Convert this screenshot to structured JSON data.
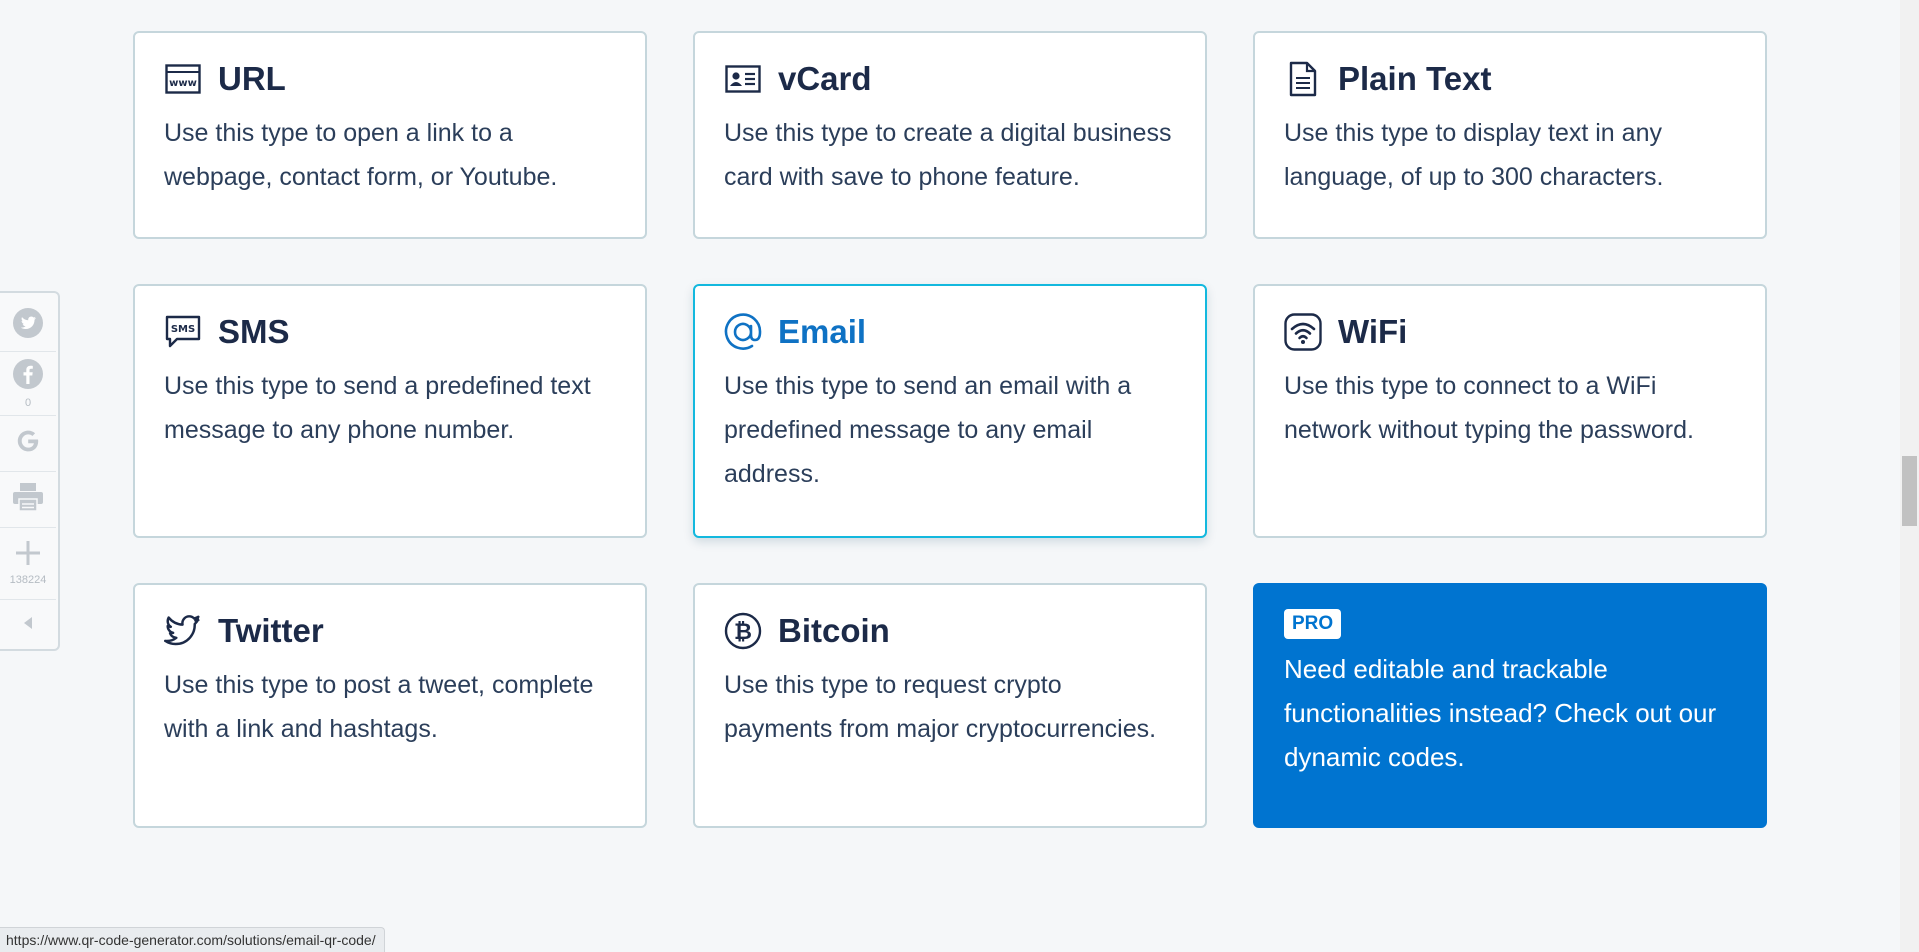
{
  "cards": [
    {
      "icon": "www-icon",
      "title": "URL",
      "desc": "Use this type to open a link to a webpage, contact form, or Youtube."
    },
    {
      "icon": "vcard-icon",
      "title": "vCard",
      "desc": "Use this type to create a digital business card with save to phone feature."
    },
    {
      "icon": "document-icon",
      "title": "Plain Text",
      "desc": "Use this type to display text in any language, of up to 300 characters."
    },
    {
      "icon": "sms-icon",
      "title": "SMS",
      "desc": "Use this type to send a predefined text message to any phone number."
    },
    {
      "icon": "at-icon",
      "title": "Email",
      "desc": "Use this type to send an email with a predefined message to any email address."
    },
    {
      "icon": "wifi-icon",
      "title": "WiFi",
      "desc": "Use this type to connect to a WiFi network without typing the password."
    },
    {
      "icon": "twitter-icon",
      "title": "Twitter",
      "desc": "Use this type to post a tweet, complete with a link and hashtags."
    },
    {
      "icon": "bitcoin-icon",
      "title": "Bitcoin",
      "desc": "Use this type to request crypto payments from major cryptocurrencies."
    }
  ],
  "pro": {
    "badge": "PRO",
    "desc": "Need editable and trackable functionalities instead? Check out our dynamic codes."
  },
  "share": {
    "facebook_count": "0",
    "total_count": "138224"
  },
  "icon_names": [
    "twitter-icon",
    "facebook-icon",
    "google-icon",
    "printer-icon",
    "plus-icon",
    "collapse-icon"
  ],
  "status_url": "https://www.qr-code-generator.com/solutions/email-qr-code/",
  "colors": {
    "accent": "#0f72c4",
    "active_border": "#13b8de",
    "pro_bg": "#0074d0",
    "title": "#1c2a48"
  }
}
